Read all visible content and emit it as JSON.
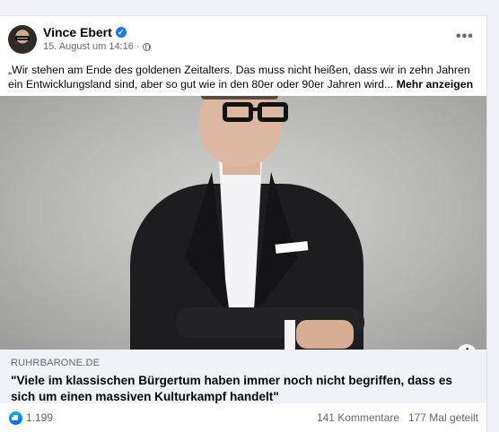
{
  "post": {
    "author": "Vince Ebert",
    "timestamp": "15. August um 14:16",
    "separator": "·",
    "verified_glyph": "✓",
    "more_options_glyph": "•••",
    "text": "„Wir stehen am Ende des goldenen Zeitalters. Das muss nicht heißen, dass wir in zehn Jahren ein Entwicklungsland sind, aber so gut wie in den 80er oder 90er Jahren wird...",
    "see_more": "Mehr anzeigen"
  },
  "link_preview": {
    "domain": "RUHRBARONE.DE",
    "headline": "\"Viele im klassischen Bürgertum haben immer noch nicht begriffen, dass es sich um einen massiven Kulturkampf handelt\"",
    "info_glyph": "i"
  },
  "stats": {
    "likes": "1.199",
    "comments": "141 Kommentare",
    "shares": "177 Mal geteilt"
  },
  "icons": {
    "verified": "verified-badge-icon",
    "privacy": "globe-icon",
    "reaction": "like-icon"
  },
  "colors": {
    "accent": "#1877f2",
    "secondary_text": "#65676b",
    "link_box_bg": "#f0f2f5"
  }
}
